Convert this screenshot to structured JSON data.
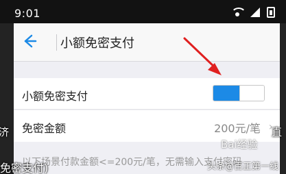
{
  "status_bar": {
    "time": "9:01"
  },
  "header": {
    "title": "小额免密支付"
  },
  "settings": [
    {
      "label": "小额免密支付",
      "control": "toggle",
      "enabled": true
    },
    {
      "label": "免密金额",
      "value": "200元/笔",
      "chevron": "›"
    }
  ],
  "footnote": "以下场景付款金额<=200元/笔，无需输入支付密码",
  "overlay": {
    "left_text": "济",
    "right_text": "直",
    "bottom_text": "免密支付)",
    "watermark": "Bai经验",
    "watermark_credit": "头条@百正第一线"
  },
  "colors": {
    "accent": "#1c8ae6",
    "arrow": "#e02020"
  },
  "icons": {
    "back": "arrow-left-icon",
    "wifi": "wifi-icon",
    "signal": "signal-icon",
    "battery": "battery-icon",
    "annotation": "red-arrow-icon"
  }
}
